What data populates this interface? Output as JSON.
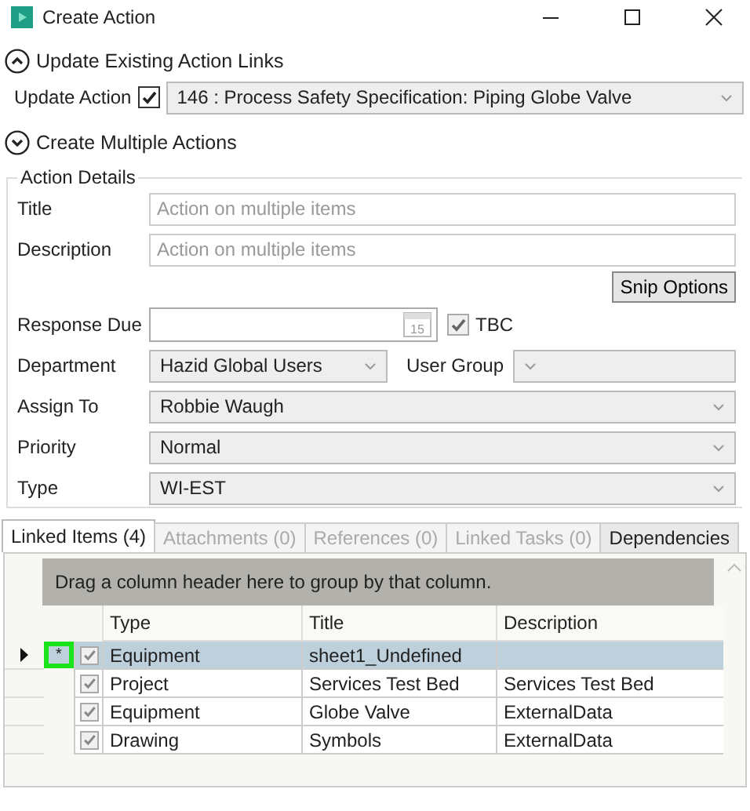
{
  "window": {
    "title": "Create Action"
  },
  "update_section": {
    "label": "Update Existing Action Links",
    "expanded": true,
    "action_label": "Update Action",
    "action_checked": true,
    "action_value": "146 : Process Safety Specification: Piping Globe Valve"
  },
  "create_section": {
    "label": "Create Multiple Actions",
    "expanded": false
  },
  "details": {
    "legend": "Action Details",
    "fields": [
      {
        "kind": "text",
        "label": "Title",
        "placeholder": "Action on multiple items"
      },
      {
        "kind": "text",
        "label": "Description",
        "placeholder": "Action on multiple items"
      },
      {
        "kind": "button",
        "label": "Snip Options"
      },
      {
        "kind": "date",
        "label": "Response Due",
        "calendar_day": "15",
        "tbc_label": "TBC",
        "tbc_checked": true
      },
      {
        "kind": "combo-pair",
        "label": "Department",
        "value": "Hazid Global Users",
        "second_label": "User Group"
      },
      {
        "kind": "combo",
        "label": "Assign To",
        "value": "Robbie Waugh"
      },
      {
        "kind": "combo",
        "label": "Priority",
        "value": "Normal"
      },
      {
        "kind": "combo",
        "label": "Type",
        "value": "WI-EST"
      }
    ]
  },
  "tabs": [
    {
      "label": "Linked Items (4)",
      "selected": true,
      "disabled": false
    },
    {
      "label": "Attachments (0)",
      "selected": false,
      "disabled": true
    },
    {
      "label": "References (0)",
      "selected": false,
      "disabled": true
    },
    {
      "label": "Linked Tasks (0)",
      "selected": false,
      "disabled": true
    },
    {
      "label": "Dependencies",
      "selected": false,
      "disabled": false
    }
  ],
  "grid": {
    "group_hint": "Drag a column header here to group by that column.",
    "columns": [
      "Type",
      "Title",
      "Description"
    ],
    "rows": [
      {
        "selected": true,
        "marker": "*",
        "checked": true,
        "cells": [
          "Equipment",
          "sheet1_Undefined"
        ]
      },
      {
        "selected": false,
        "checked": true,
        "cells": [
          "Project",
          "Services Test Bed",
          "Services Test Bed"
        ]
      },
      {
        "selected": false,
        "checked": true,
        "cells": [
          "Equipment",
          "Globe Valve",
          "ExternalData"
        ]
      },
      {
        "selected": false,
        "checked": true,
        "cells": [
          "Drawing",
          "Symbols",
          "ExternalData"
        ]
      }
    ]
  }
}
